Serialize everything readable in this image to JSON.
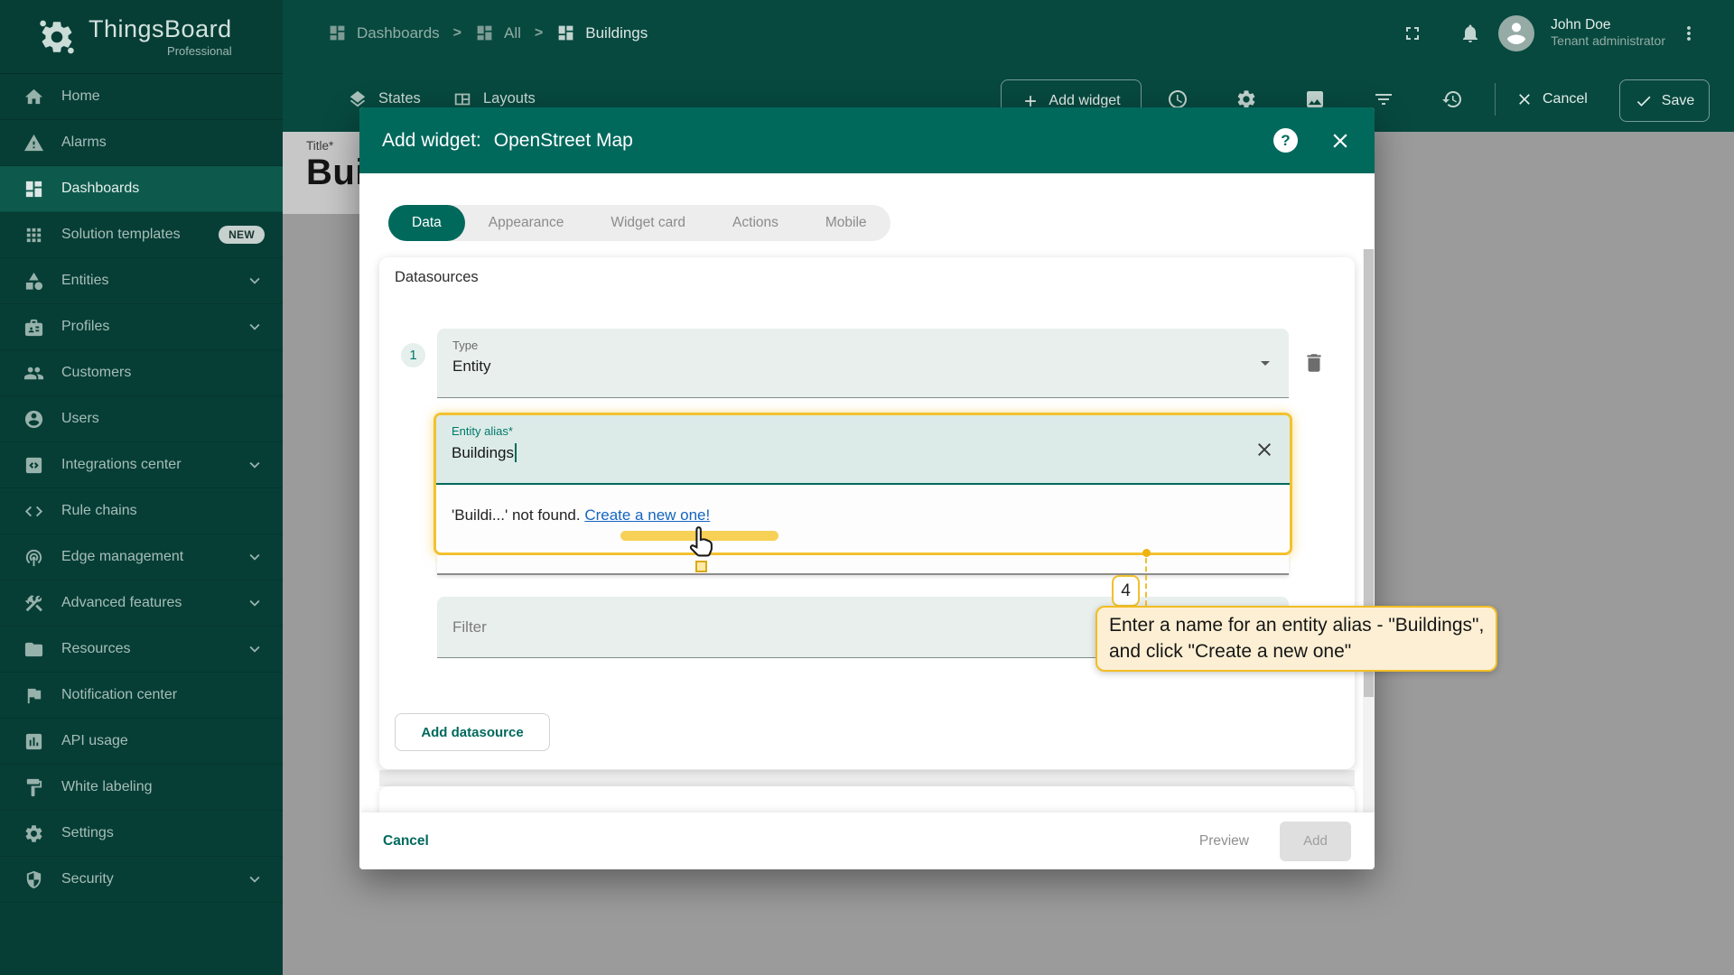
{
  "app": {
    "name": "ThingsBoard",
    "edition": "Professional"
  },
  "breadcrumb": {
    "items": [
      "Dashboards",
      "All",
      "Buildings"
    ]
  },
  "user": {
    "name": "John Doe",
    "role": "Tenant administrator"
  },
  "sidebar": {
    "items": [
      {
        "label": "Home",
        "icon": "home"
      },
      {
        "label": "Alarms",
        "icon": "warning"
      },
      {
        "label": "Dashboards",
        "icon": "dashboard",
        "active": true
      },
      {
        "label": "Solution templates",
        "icon": "apps",
        "badge": "NEW"
      },
      {
        "label": "Entities",
        "icon": "category",
        "expandable": true
      },
      {
        "label": "Profiles",
        "icon": "badge",
        "expandable": true
      },
      {
        "label": "Customers",
        "icon": "group"
      },
      {
        "label": "Users",
        "icon": "account"
      },
      {
        "label": "Integrations center",
        "icon": "codebox",
        "expandable": true
      },
      {
        "label": "Rule chains",
        "icon": "code"
      },
      {
        "label": "Edge management",
        "icon": "tether",
        "expandable": true
      },
      {
        "label": "Advanced features",
        "icon": "construction",
        "expandable": true
      },
      {
        "label": "Resources",
        "icon": "folder",
        "expandable": true
      },
      {
        "label": "Notification center",
        "icon": "flag"
      },
      {
        "label": "API usage",
        "icon": "chart"
      },
      {
        "label": "White labeling",
        "icon": "paint"
      },
      {
        "label": "Settings",
        "icon": "gear"
      },
      {
        "label": "Security",
        "icon": "shield",
        "expandable": true
      }
    ]
  },
  "toolbar": {
    "states": "States",
    "layouts": "Layouts",
    "add_widget": "Add widget",
    "icons": [
      "time-window",
      "dashboard-settings",
      "manage-states-image",
      "filter",
      "version-history"
    ],
    "cancel": "Cancel",
    "save": "Save"
  },
  "canvas": {
    "title_label": "Title*",
    "title_value": "Bui"
  },
  "dialog": {
    "title_prefix": "Add widget:",
    "widget_name": "OpenStreet Map",
    "tabs": [
      "Data",
      "Appearance",
      "Widget card",
      "Actions",
      "Mobile"
    ],
    "active_tab": "Data",
    "datasources": {
      "heading": "Datasources",
      "index": "1",
      "type_label": "Type",
      "type_value": "Entity",
      "alias_label": "Entity alias*",
      "alias_value": "Buildings",
      "not_found": "'Buildi...' not found. ",
      "create_link": "Create a new one!",
      "filter_placeholder": "Filter",
      "add_button": "Add datasource"
    },
    "footer": {
      "cancel": "Cancel",
      "preview": "Preview",
      "add": "Add"
    }
  },
  "tour": {
    "step": "4",
    "line1": "Enter a name for an entity alias - \"Buildings\",",
    "line2": "and click \"Create a new one\""
  },
  "colors": {
    "accent": "#00695C",
    "sidebar_bg": "#063E36",
    "topbar_bg": "#07493F",
    "gold": "#F2C230",
    "tooltip_bg": "#FCEFD3",
    "link": "#1565C0"
  }
}
